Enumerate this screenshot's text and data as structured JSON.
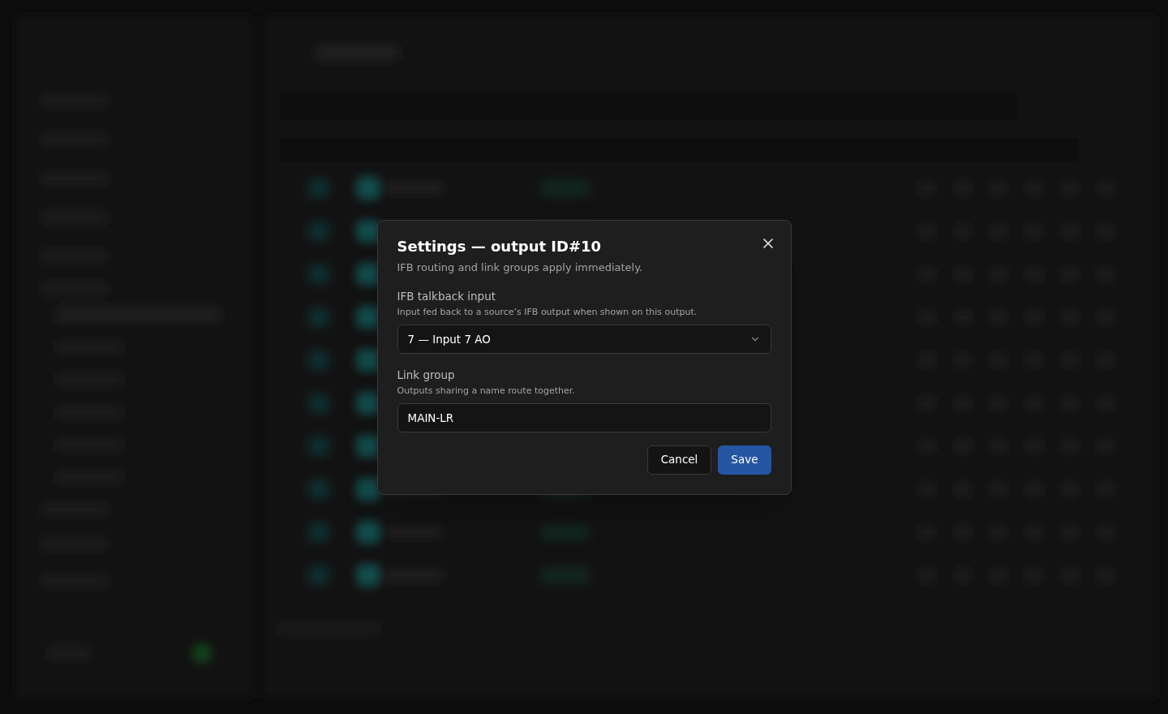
{
  "dialog": {
    "title": "Settings — output ID#10",
    "description": "IFB routing and link groups apply immediately.",
    "fields": [
      {
        "kind": "select",
        "label": "IFB talkback input",
        "hint": "Input fed back to a source’s IFB output when shown on this output.",
        "value": "7 — Input 7 AO"
      },
      {
        "kind": "text",
        "label": "Link group",
        "hint": "Outputs sharing a name route together.",
        "value": "MAIN-LR"
      }
    ],
    "buttons": [
      {
        "label": "Cancel",
        "kind": "secondary"
      },
      {
        "label": "Save",
        "kind": "primary"
      }
    ]
  }
}
